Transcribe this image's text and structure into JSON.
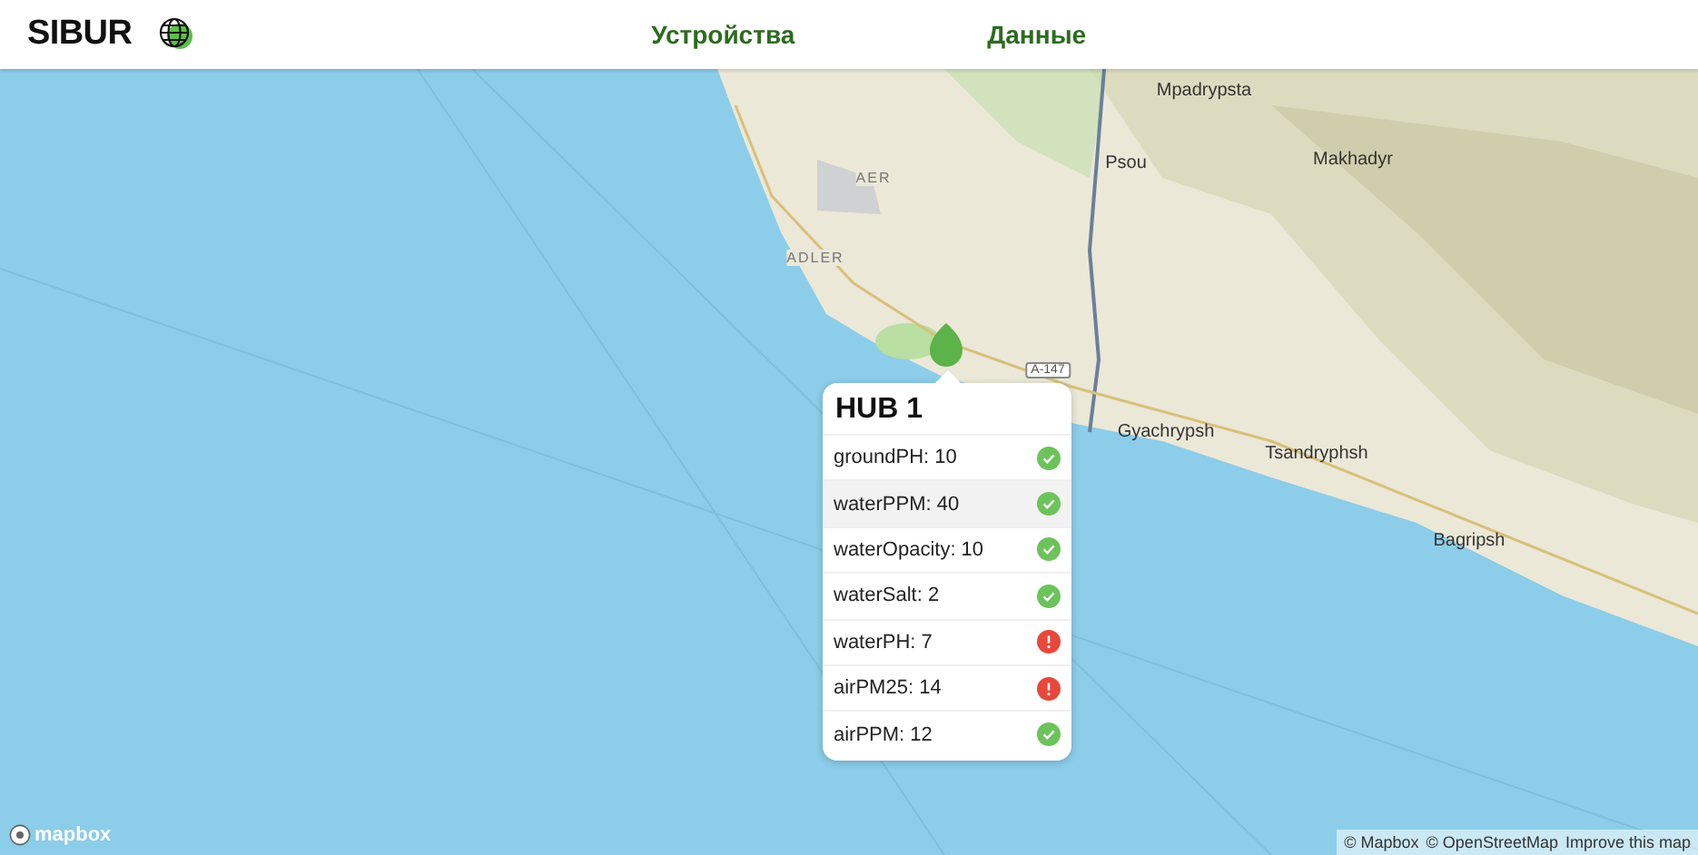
{
  "header": {
    "logo": "SIBUR",
    "nav": [
      {
        "label": "Устройства"
      },
      {
        "label": "Данные"
      }
    ]
  },
  "map": {
    "labels": [
      {
        "text": "AER",
        "kind": "airport"
      },
      {
        "text": "ADLER",
        "kind": "town"
      },
      {
        "text": "Psou",
        "kind": "place"
      },
      {
        "text": "Mpadrypsta",
        "kind": "place"
      },
      {
        "text": "Makhadyr",
        "kind": "place"
      },
      {
        "text": "Gyachrypsh",
        "kind": "place"
      },
      {
        "text": "Tsandryphsh",
        "kind": "place"
      },
      {
        "text": "Bagripsh",
        "kind": "place"
      },
      {
        "text": "A-147",
        "kind": "road"
      }
    ],
    "popup": {
      "title": "HUB 1",
      "rows": [
        {
          "text": "groundPH: 10",
          "kind": "ok",
          "selected": false
        },
        {
          "text": "waterPPM: 40",
          "kind": "ok",
          "selected": true
        },
        {
          "text": "waterOpacity: 10",
          "kind": "ok",
          "selected": false
        },
        {
          "text": "waterSalt: 2",
          "kind": "ok",
          "selected": false
        },
        {
          "text": "waterPH: 7",
          "kind": "alert",
          "selected": false
        },
        {
          "text": "airPM25: 14",
          "kind": "alert",
          "selected": false
        },
        {
          "text": "airPPM: 12",
          "kind": "ok",
          "selected": false
        }
      ]
    },
    "logo": "mapbox",
    "attribution": [
      "© Mapbox",
      "© OpenStreetMap",
      "Improve this map"
    ]
  }
}
